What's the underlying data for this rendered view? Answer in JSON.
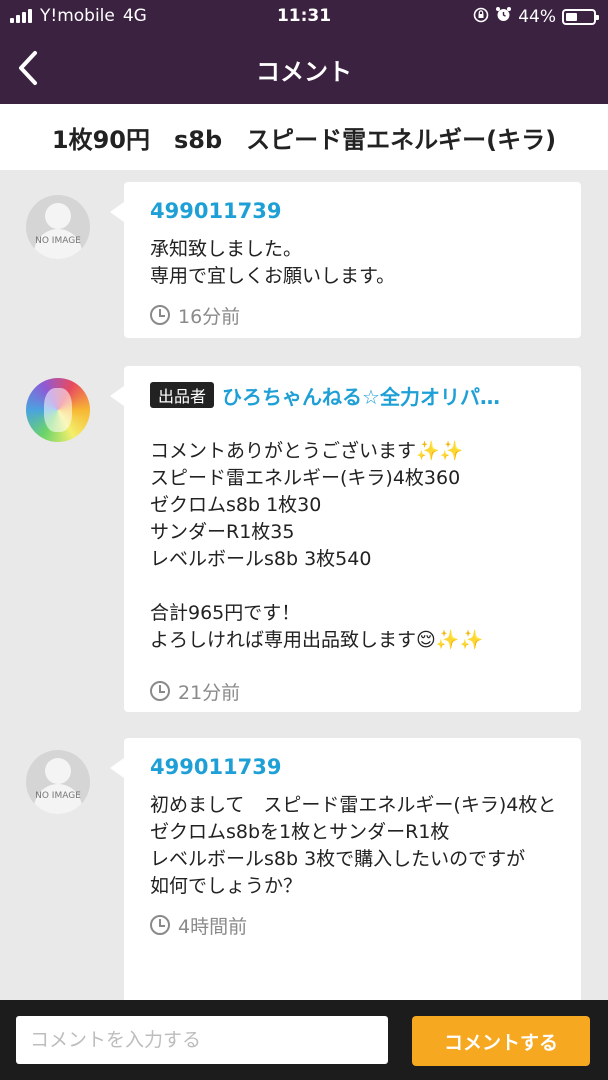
{
  "status_bar": {
    "carrier": "Y!mobile",
    "network": "4G",
    "time": "11:31",
    "battery": "44%",
    "battery_level": 0.44
  },
  "header": {
    "title": "コメント"
  },
  "product": {
    "title": "1枚90円　s8b　スピード雷エネルギー(キラ)"
  },
  "comments": [
    {
      "user": "499011739",
      "avatar_label": "NO IMAGE",
      "text": "承知致しました。\n専用で宜しくお願いします。",
      "time": "16分前"
    },
    {
      "badge": "出品者",
      "user": "ひろちゃんねる☆全力オリパ…",
      "text": "コメントありがとうございます✨✨\nスピード雷エネルギー(キラ)4枚360\nゼクロムs8b  1枚30\nサンダーR1枚35\nレベルボールs8b 3枚540\n\n合計965円です！\nよろしければ専用出品致します😌✨✨",
      "time": "21分前"
    },
    {
      "user": "499011739",
      "avatar_label": "NO IMAGE",
      "text": "初めまして　スピード雷エネルギー(キラ)4枚とゼクロムs8bを1枚とサンダーR1枚\nレベルボールs8b 3枚で購入したいのですが\n如何でしょうか？",
      "time": "4時間前"
    }
  ],
  "footer": {
    "input_placeholder": "コメントを入力する",
    "input_value": "",
    "send_label": "コメントする"
  },
  "colors": {
    "header_bg": "#3b2241",
    "username": "#1ea0d6",
    "send_button": "#f6a821"
  }
}
